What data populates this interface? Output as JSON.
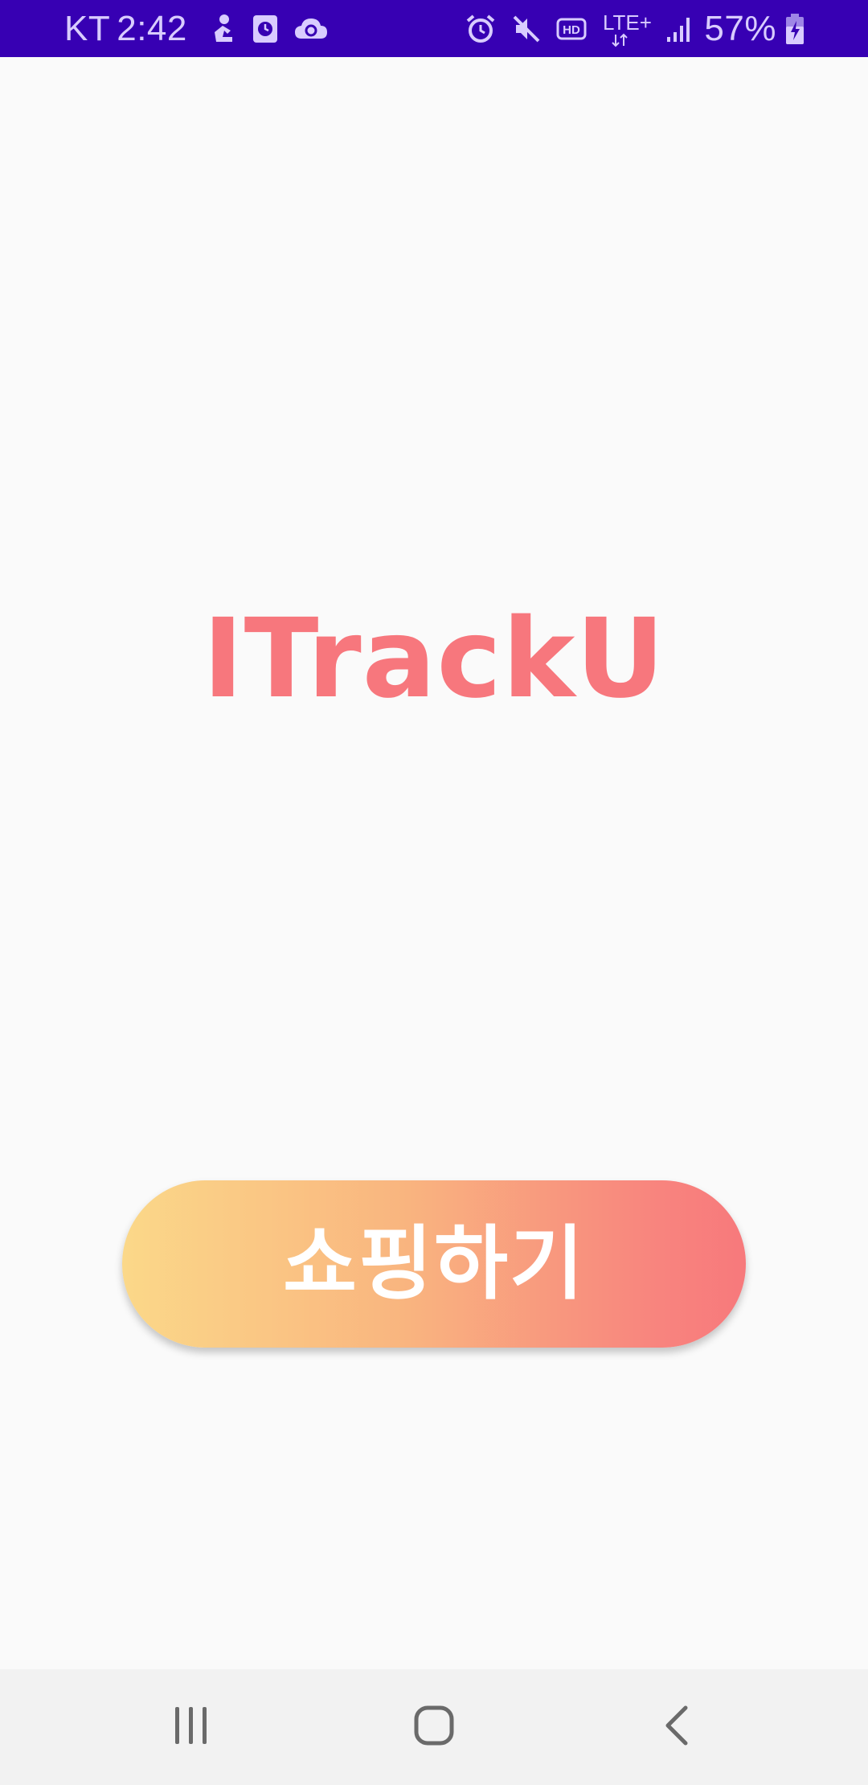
{
  "status_bar": {
    "carrier": "KT",
    "time": "2:42",
    "battery_percent": "57%",
    "network": "LTE+",
    "hd_label": "HD",
    "background_color": "#3700b3",
    "left_icons": [
      "person-sync-icon",
      "clock-app-icon",
      "cloud-sync-icon"
    ],
    "right_icons": [
      "alarm-icon",
      "mute-icon",
      "hd-voice-icon",
      "lte-plus-icon",
      "signal-icon",
      "battery-charging-icon"
    ]
  },
  "main": {
    "app_title": "ITrackU",
    "shop_button_label": "쇼핑하기",
    "accent_color": "#f7777d",
    "button_gradient": [
      "#fbd889",
      "#f7797c"
    ]
  },
  "nav_bar": {
    "buttons": [
      "recents-icon",
      "home-icon",
      "back-icon"
    ]
  }
}
